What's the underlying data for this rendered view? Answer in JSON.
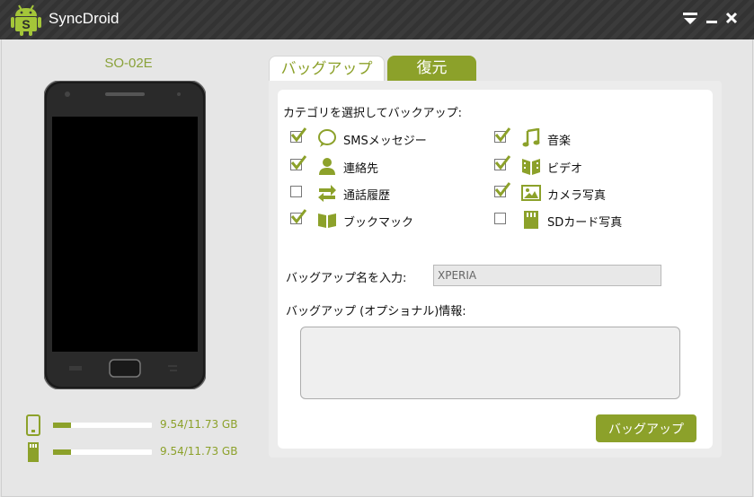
{
  "app": {
    "title": "SyncDroid"
  },
  "window_controls": {
    "menu_icon": "dropdown-menu-icon",
    "minimize_icon": "minimize-icon",
    "close_icon": "close-icon"
  },
  "device": {
    "name": "SO-02E"
  },
  "storage": [
    {
      "icon": "phone-storage-icon",
      "used_fraction": 0.181,
      "text": "9.54/11.73 GB"
    },
    {
      "icon": "sd-card-icon",
      "used_fraction": 0.181,
      "text": "9.54/11.73 GB"
    }
  ],
  "tabs": [
    {
      "label": "バッグアップ",
      "active": true
    },
    {
      "label": "復元",
      "active": false
    }
  ],
  "categories": {
    "heading": "カテゴリを選択してバックアップ:",
    "items": [
      {
        "label": "SMSメッセジー",
        "checked": true,
        "icon": "speech-bubble-icon"
      },
      {
        "label": "連絡先",
        "checked": true,
        "icon": "contact-person-icon"
      },
      {
        "label": "通話履歴",
        "checked": false,
        "icon": "call-arrows-icon"
      },
      {
        "label": "ブックマック",
        "checked": true,
        "icon": "open-book-icon"
      },
      {
        "label": "音楽",
        "checked": true,
        "icon": "music-note-icon"
      },
      {
        "label": "ビデオ",
        "checked": true,
        "icon": "film-reel-icon"
      },
      {
        "label": "カメラ写真",
        "checked": true,
        "icon": "photo-icon"
      },
      {
        "label": "SDカード写真",
        "checked": false,
        "icon": "sd-card-photo-icon"
      }
    ]
  },
  "backup_name": {
    "label": "バッグアップ名を入力:",
    "value": "XPERIA"
  },
  "backup_info": {
    "label": "バッグアップ (オプショナル)情報:",
    "value": ""
  },
  "backup_button": {
    "label": "バッグアップ"
  },
  "colors": {
    "accent": "#8ca12a",
    "titlebar": "#383838",
    "background": "#e6e6e6"
  }
}
